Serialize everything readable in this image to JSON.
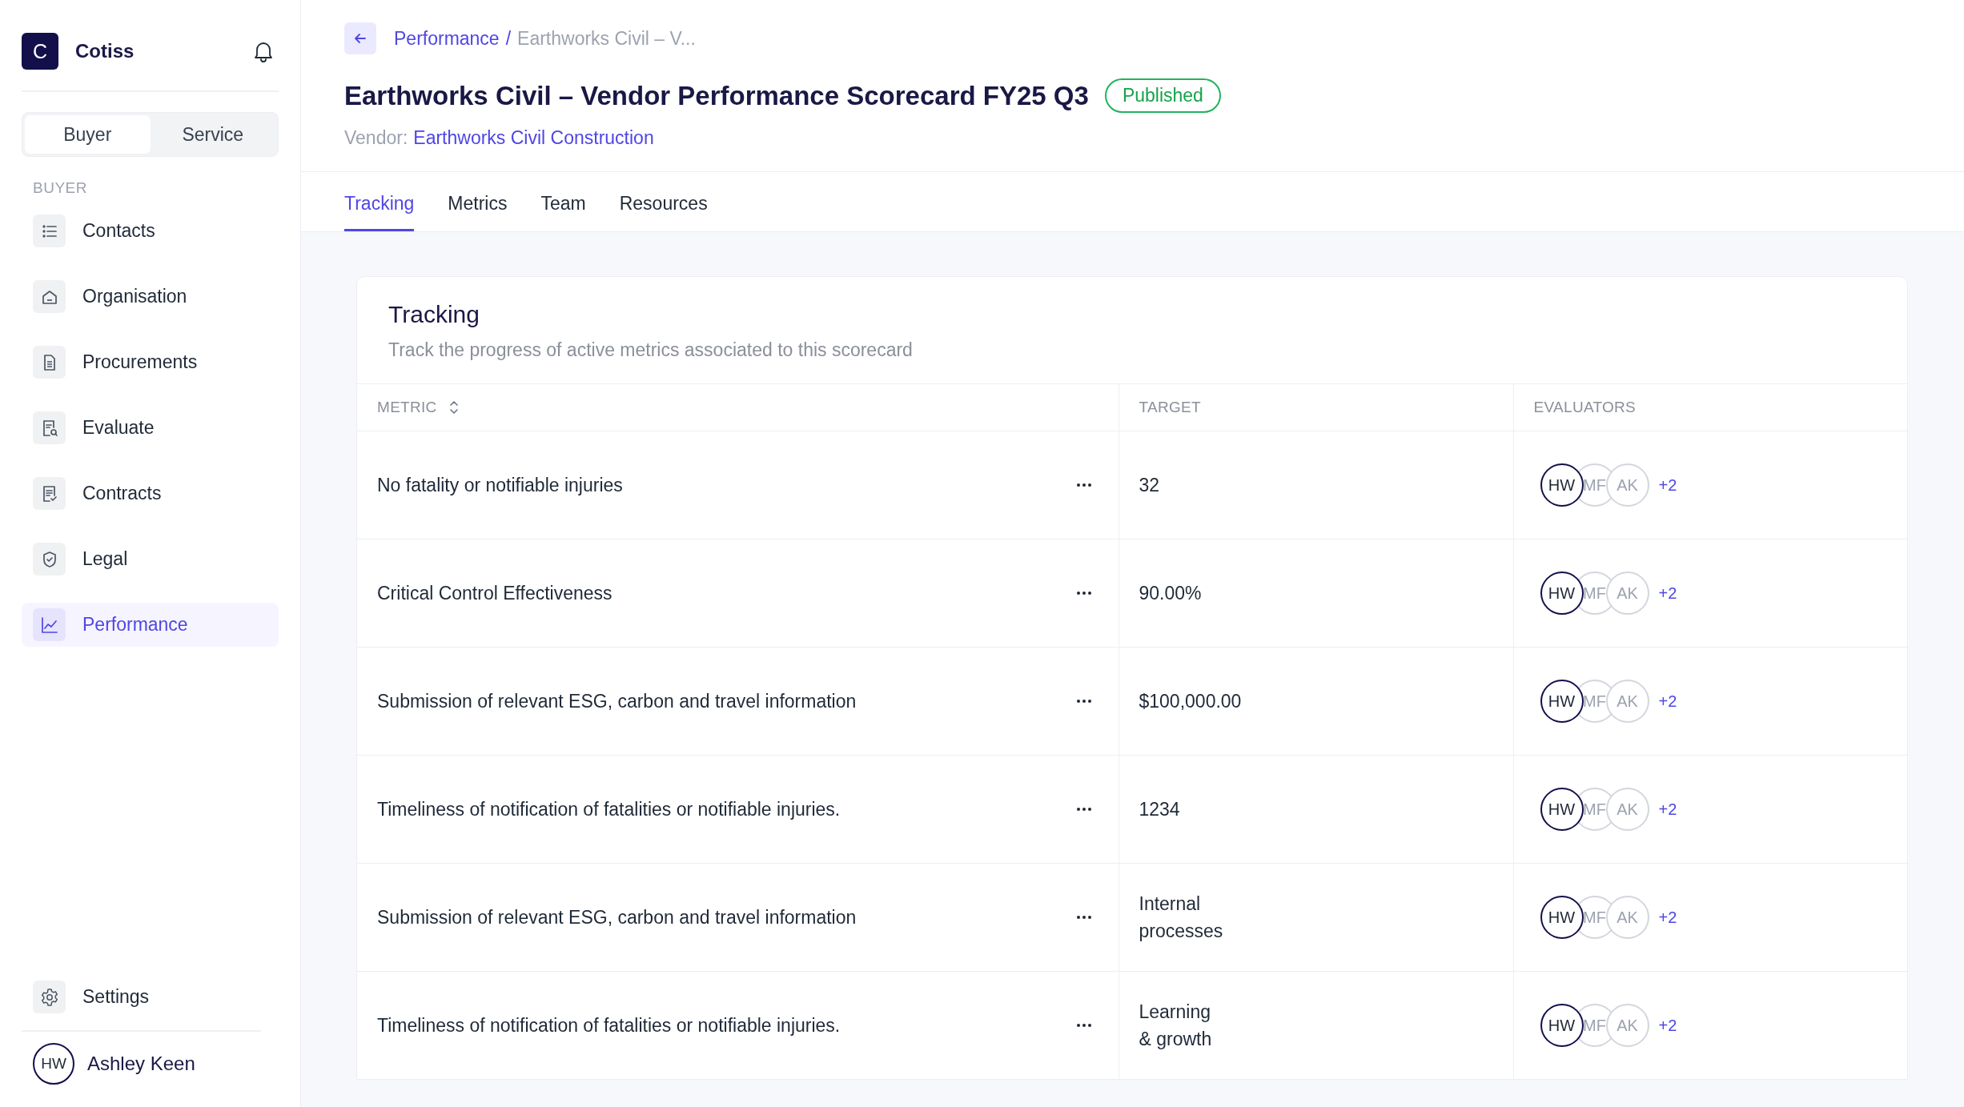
{
  "sidebar": {
    "brand": {
      "initial": "C",
      "name": "Cotiss"
    },
    "mode_toggle": [
      {
        "label": "Buyer",
        "selected": true
      },
      {
        "label": "Service",
        "selected": false
      }
    ],
    "section_label": "BUYER",
    "items": [
      {
        "label": "Contacts",
        "selected": false
      },
      {
        "label": "Organisation",
        "selected": false
      },
      {
        "label": "Procurements",
        "selected": false
      },
      {
        "label": "Evaluate",
        "selected": false
      },
      {
        "label": "Contracts",
        "selected": false
      },
      {
        "label": "Legal",
        "selected": false
      },
      {
        "label": "Performance",
        "selected": true
      }
    ],
    "settings": {
      "label": "Settings"
    },
    "user": {
      "initials": "HW",
      "name": "Ashley Keen"
    }
  },
  "header": {
    "breadcrumb": {
      "link": "Performance",
      "separator": "/",
      "current": "Earthworks Civil – V..."
    },
    "title": "Earthworks Civil – Vendor Performance Scorecard FY25 Q3",
    "status": "Published",
    "vendor_label": "Vendor:",
    "vendor_link": "Earthworks Civil Construction"
  },
  "tabs": [
    {
      "label": "Tracking",
      "selected": true
    },
    {
      "label": "Metrics",
      "selected": false
    },
    {
      "label": "Team",
      "selected": false
    },
    {
      "label": "Resources",
      "selected": false
    }
  ],
  "card": {
    "title": "Tracking",
    "subtitle": "Track the progress of active metrics associated to this scorecard",
    "table": {
      "columns": [
        {
          "label": "METRIC",
          "sortable": true
        },
        {
          "label": "TARGET",
          "sortable": false
        },
        {
          "label": "EVALUATORS",
          "sortable": false
        }
      ],
      "rows": [
        {
          "metric": "No fatality or notifiable injuries",
          "target": "32",
          "evaluators": [
            {
              "initials": "HW",
              "lead": true
            },
            {
              "initials": "MF",
              "lead": false
            },
            {
              "initials": "AK",
              "lead": false
            }
          ],
          "more": "+2"
        },
        {
          "metric": "Critical Control Effectiveness",
          "target": "90.00%",
          "evaluators": [
            {
              "initials": "HW",
              "lead": true
            },
            {
              "initials": "MF",
              "lead": false
            },
            {
              "initials": "AK",
              "lead": false
            }
          ],
          "more": "+2"
        },
        {
          "metric": "Submission of relevant ESG, carbon and travel information",
          "target": "$100,000.00",
          "evaluators": [
            {
              "initials": "HW",
              "lead": true
            },
            {
              "initials": "MF",
              "lead": false
            },
            {
              "initials": "AK",
              "lead": false
            }
          ],
          "more": "+2"
        },
        {
          "metric": "Timeliness of notification of fatalities or notifiable injuries.",
          "target": "1234",
          "evaluators": [
            {
              "initials": "HW",
              "lead": true
            },
            {
              "initials": "MF",
              "lead": false
            },
            {
              "initials": "AK",
              "lead": false
            }
          ],
          "more": "+2"
        },
        {
          "metric": "Submission of relevant ESG, carbon and travel information",
          "target": "Internal processes",
          "evaluators": [
            {
              "initials": "HW",
              "lead": true
            },
            {
              "initials": "MF",
              "lead": false
            },
            {
              "initials": "AK",
              "lead": false
            }
          ],
          "more": "+2"
        },
        {
          "metric": "Timeliness of notification of fatalities or notifiable injuries.",
          "target": "Learning & growth",
          "evaluators": [
            {
              "initials": "HW",
              "lead": true
            },
            {
              "initials": "MF",
              "lead": false
            },
            {
              "initials": "AK",
              "lead": false
            }
          ],
          "more": "+2"
        }
      ]
    }
  }
}
